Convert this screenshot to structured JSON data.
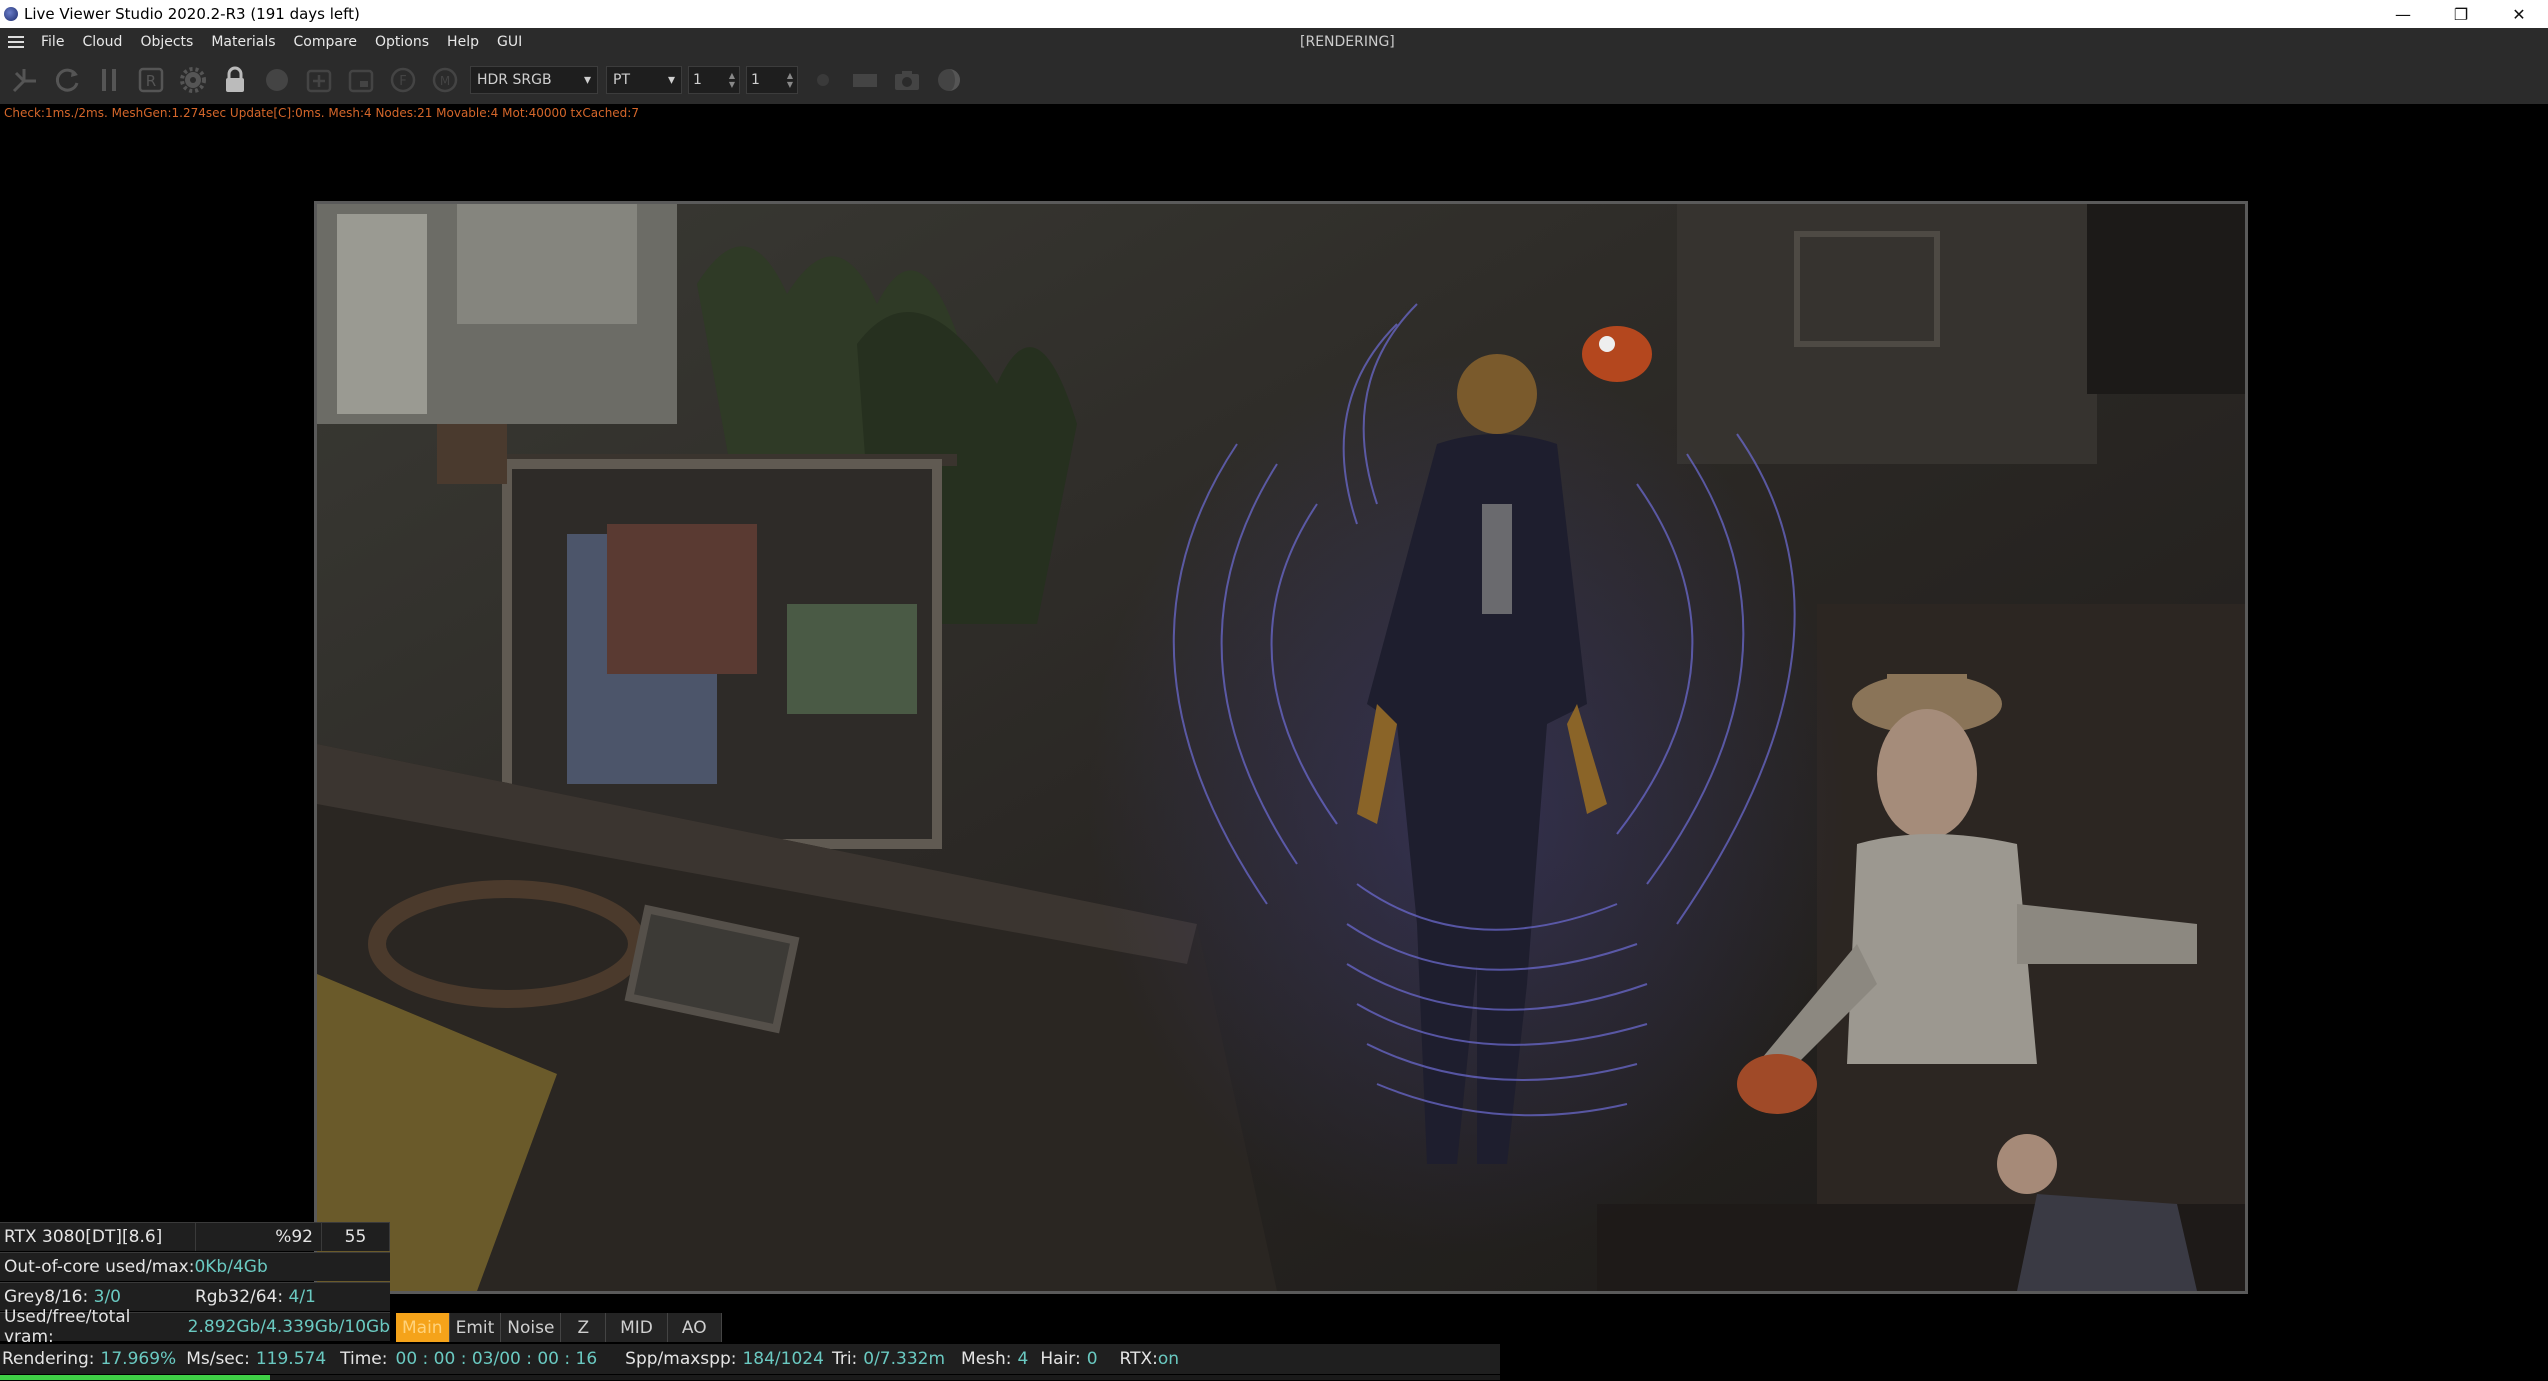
{
  "window": {
    "title": "Live Viewer Studio 2020.2-R3 (191 days left)",
    "minimize": "—",
    "restore": "❐",
    "close": "✕"
  },
  "menu": {
    "items": [
      "File",
      "Cloud",
      "Objects",
      "Materials",
      "Compare",
      "Options",
      "Help",
      "GUI"
    ],
    "status": "[RENDERING]"
  },
  "toolbar": {
    "color_space": "HDR SRGB",
    "kernel": "PT",
    "spin1": "1",
    "spin2": "1"
  },
  "debug": "Check:1ms./2ms. MeshGen:1.274sec Update[C]:0ms. Mesh:4 Nodes:21 Movable:4 Mot:40000 txCached:7",
  "stats": {
    "gpu": "RTX 3080[DT][8.6]",
    "gpu_pct": "%92",
    "gpu_temp": "55",
    "ooc_label": "Out-of-core used/max:",
    "ooc_value": "0Kb/4Gb",
    "grey_label": "Grey8/16:",
    "grey_value": "3/0",
    "rgb_label": "Rgb32/64:",
    "rgb_value": "4/1",
    "vram_label": "Used/free/total vram:",
    "vram_value": "2.892Gb/4.339Gb/10Gb"
  },
  "tabs": [
    "Main",
    "Emit",
    "Noise",
    "Z",
    "MID",
    "AO"
  ],
  "status": {
    "rendering_label": "Rendering:",
    "rendering_value": "17.969%",
    "ms_label": "Ms/sec:",
    "ms_value": "119.574",
    "time_label": "Time:",
    "time_value": "00 : 00 : 03/00 : 00 : 16",
    "spp_label": "Spp/maxspp:",
    "spp_value": "184/1024",
    "tri_label": "Tri:",
    "tri_value": "0/7.332m",
    "mesh_label": "Mesh:",
    "mesh_value": "4",
    "hair_label": "Hair:",
    "hair_value": "0",
    "rtx_label": "RTX:",
    "rtx_value": "on"
  },
  "progress": 0.17969,
  "colors": {
    "accent_orange": "#f5a31a",
    "value_cyan": "#6ac9c1",
    "progress_green": "#3fd046",
    "debug_orange": "#d4662a"
  }
}
